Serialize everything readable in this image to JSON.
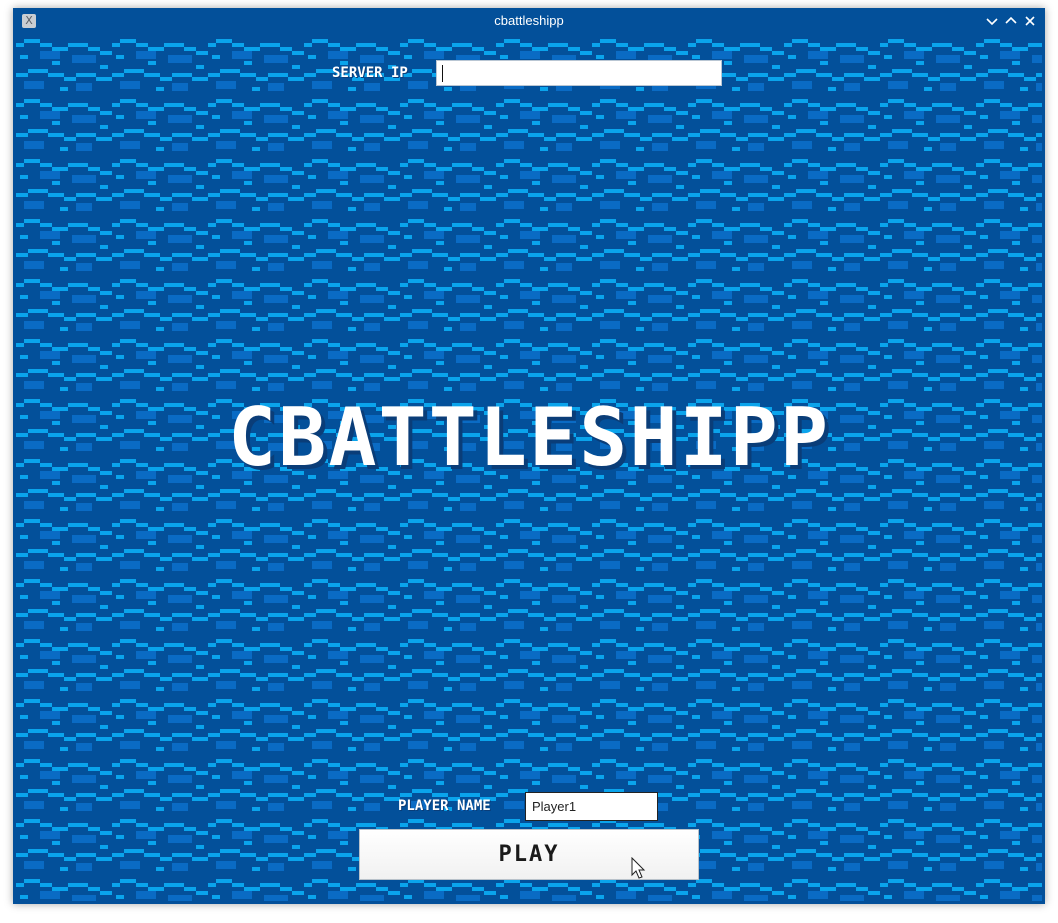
{
  "window": {
    "title": "cbattleshipp",
    "app_icon": "X",
    "controls": [
      "chevron-down-icon",
      "chevron-up-icon",
      "close-icon"
    ]
  },
  "colors": {
    "title_bar": "#03509a",
    "water_dark": "#03509a",
    "water_mid": "#0a6bc4",
    "water_light": "#0aa4ec",
    "text": "#ffffff"
  },
  "server": {
    "label": "SERVER IP",
    "value": ""
  },
  "logo": {
    "text": "CBATTLESHIPP"
  },
  "player": {
    "label": "PLAYER NAME",
    "value": "Player1"
  },
  "play_button": {
    "label": "PLAY"
  }
}
